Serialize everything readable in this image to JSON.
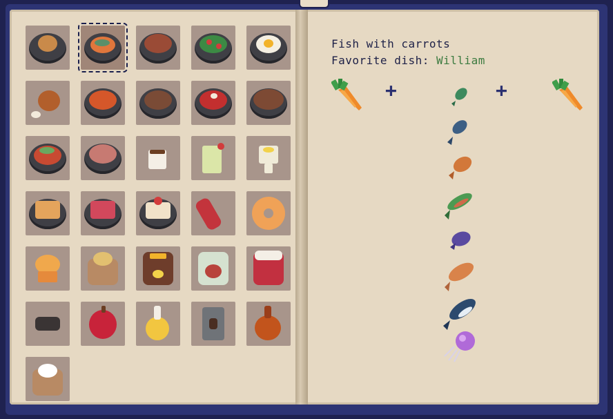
{
  "recipe": {
    "title": "Fish with carrots",
    "favorite_label": "Favorite dish: ",
    "favorite_name": "William"
  },
  "recipe_slots": [
    {
      "icon": "carrot-icon"
    },
    {
      "icon": "plus-icon",
      "text": "+"
    },
    {
      "icon": "fish-options"
    },
    {
      "icon": "plus-icon",
      "text": "+"
    },
    {
      "icon": "carrot-icon"
    }
  ],
  "fish_options": [
    "green-fish-icon",
    "blue-fish-icon",
    "orange-fish-icon",
    "green-trout-icon",
    "purple-fish-icon",
    "orange-trout-icon",
    "shark-icon",
    "jellyfish-icon"
  ],
  "dishes": [
    "meat-pie-dish-icon",
    "fish-with-carrots-dish-icon",
    "steak-dish-icon",
    "salad-dish-icon",
    "fried-egg-dish-icon",
    "chicken-leg-icon",
    "tomato-soup-icon",
    "meat-stew-icon",
    "borscht-icon",
    "meatballs-dish-icon",
    "shrimp-salad-icon",
    "bacon-dish-icon",
    "coffee-cup-icon",
    "lemonade-icon",
    "lemon-tea-icon",
    "pie-slice-icon",
    "cherry-cake-icon",
    "strawberry-cake-icon",
    "sausage-icon",
    "donut-icon",
    "muffin-icon",
    "flour-sack-icon",
    "honey-jar-icon",
    "pickled-jar-icon",
    "jam-jar-icon",
    "coal-lump-icon",
    "apple-icon",
    "oil-bottle-icon",
    "coffee-can-icon",
    "sauce-bottle-icon",
    "sugar-sack-icon"
  ],
  "colors": {
    "page": "#e6d9c3",
    "cover": "#2d3474",
    "text": "#1d2047",
    "name": "#3b7a3f",
    "slot": "#a8958b"
  }
}
